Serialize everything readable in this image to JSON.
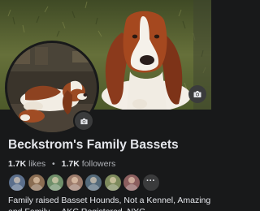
{
  "page": {
    "name": "Beckstrom's Family Bassets",
    "likes_count": "1.7K",
    "likes_label": "likes",
    "followers_count": "1.7K",
    "followers_label": "followers",
    "separator": "•",
    "bio": "Family raised Basset Hounds, Not a Kennel, Amazing and Family ... AKC Registered. NYC"
  },
  "friends": {
    "avatar_colors": [
      "#5b6f8c",
      "#8a6d52",
      "#6f8f6a",
      "#9c7b6b",
      "#546a7a",
      "#7d8a5c",
      "#8c5f5f"
    ],
    "more_label": "···"
  },
  "icons": {
    "cover_camera": "camera-icon",
    "avatar_camera": "camera-icon"
  },
  "colors": {
    "background": "#18191a",
    "text_primary": "#e4e6eb",
    "text_secondary": "#b0b3b8",
    "icon_button": "#3a3b3c"
  }
}
